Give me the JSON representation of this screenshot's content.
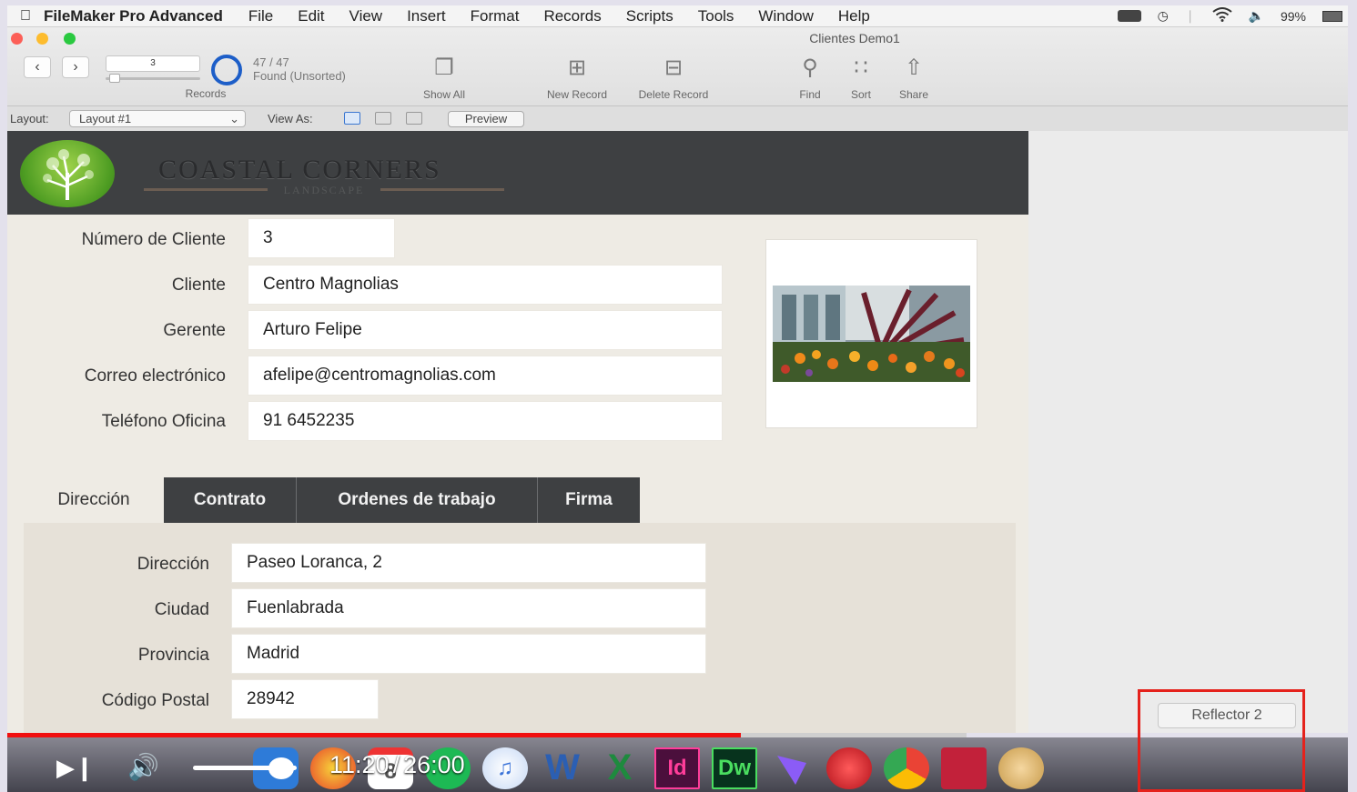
{
  "menubar": {
    "app_name": "FileMaker Pro Advanced",
    "items": [
      "File",
      "Edit",
      "View",
      "Insert",
      "Format",
      "Records",
      "Scripts",
      "Tools",
      "Window",
      "Help"
    ],
    "battery": "99%"
  },
  "window": {
    "title": "Clientes Demo1"
  },
  "toolbar": {
    "current_record": "3",
    "records_label": "Records",
    "found_count": "47 / 47",
    "found_status": "Found (Unsorted)",
    "show_all": "Show All",
    "new_record": "New Record",
    "delete_record": "Delete Record",
    "find": "Find",
    "sort": "Sort",
    "share": "Share"
  },
  "layoutbar": {
    "layout_label": "Layout:",
    "layout_value": "Layout #1",
    "view_as_label": "View As:",
    "preview": "Preview"
  },
  "brand": {
    "name": "COASTAL CORNERS",
    "tagline": "LANDSCAPE"
  },
  "client": {
    "fields": [
      {
        "label": "Número de Cliente",
        "value": "3"
      },
      {
        "label": "Cliente",
        "value": "Centro Magnolias"
      },
      {
        "label": "Gerente",
        "value": "Arturo Felipe"
      },
      {
        "label": "Correo electrónico",
        "value": "afelipe@centromagnolias.com"
      },
      {
        "label": "Teléfono Oficina",
        "value": "91 6452235"
      }
    ]
  },
  "tabs": [
    {
      "label": "Dirección",
      "active": true
    },
    {
      "label": "Contrato",
      "active": false
    },
    {
      "label": "Ordenes de trabajo",
      "active": false
    },
    {
      "label": "Firma",
      "active": false
    }
  ],
  "address": {
    "fields": [
      {
        "label": "Dirección",
        "value": "Paseo Loranca, 2"
      },
      {
        "label": "Ciudad",
        "value": "Fuenlabrada"
      },
      {
        "label": "Provincia",
        "value": "Madrid"
      },
      {
        "label": "Código Postal",
        "value": "28942"
      }
    ]
  },
  "video": {
    "current_time": "11:20",
    "separator": "/",
    "duration": "26:00",
    "progress": 0.765,
    "volume": 0.85
  },
  "dock": {
    "calendar_day": "8",
    "indesign_label": "Id",
    "dreamweaver_label": "Dw",
    "word_label": "W",
    "excel_label": "X"
  },
  "reflector": {
    "label": "Reflector 2"
  },
  "colors": {
    "header_bg": "#3e4042",
    "accent_blue": "#1d5ec8",
    "progress_red": "#f10f0f",
    "highlight_red": "#e5221c"
  }
}
